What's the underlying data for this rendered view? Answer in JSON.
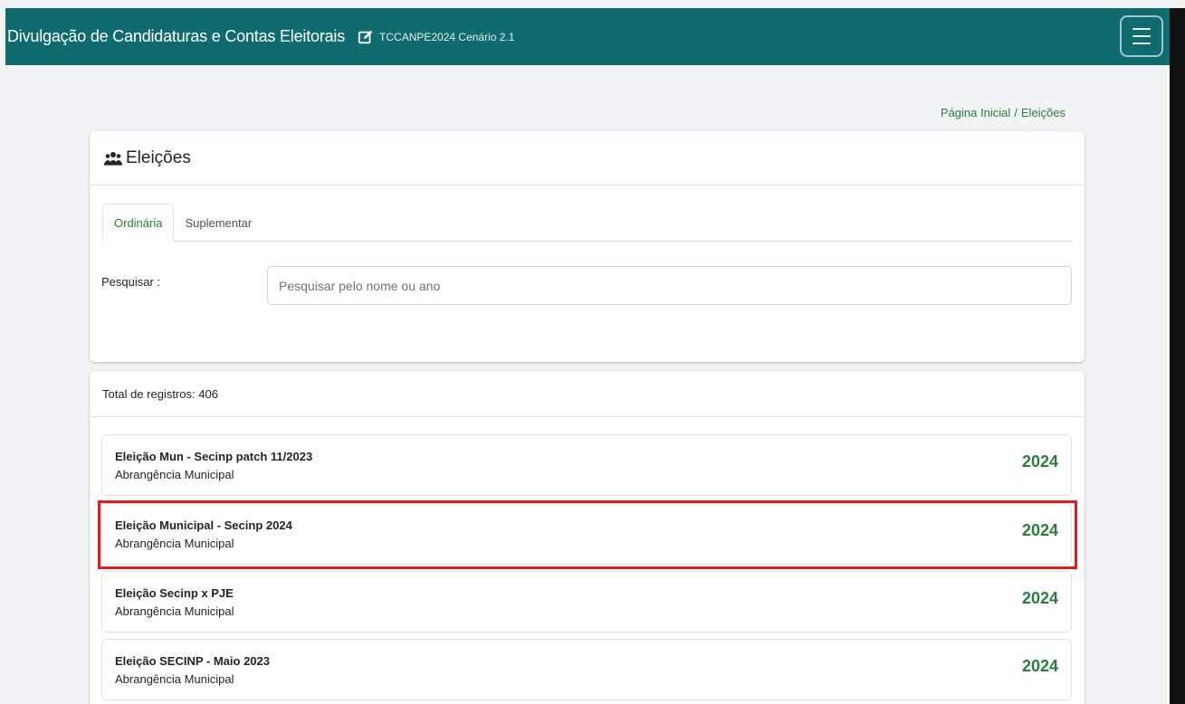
{
  "header": {
    "title": "Divulgação de Candidaturas e Contas Eleitorais",
    "subtitle": "TCCANPE2024 Cenário 2.1",
    "edit_icon": "edit-icon",
    "menu_icon": "menu-icon"
  },
  "breadcrumb": {
    "home": "Página Inicial",
    "separator": "/",
    "current": "Eleições"
  },
  "page": {
    "title": "Eleições",
    "title_icon": "users-icon"
  },
  "tabs": [
    {
      "label": "Ordinária",
      "active": true
    },
    {
      "label": "Suplementar",
      "active": false
    }
  ],
  "search": {
    "label": "Pesquisar :",
    "placeholder": "Pesquisar pelo nome ou ano",
    "value": ""
  },
  "results": {
    "total_label": "Total de registros:",
    "total_value": "406",
    "items": [
      {
        "name": "Eleição Mun - Secinp patch 11/2023",
        "scope": "Abrangência Municipal",
        "year": "2024"
      },
      {
        "name": "Eleição Municipal - Secinp 2024",
        "scope": "Abrangência Municipal",
        "year": "2024",
        "highlighted": true
      },
      {
        "name": "Eleição Secinp x PJE",
        "scope": "Abrangência Municipal",
        "year": "2024"
      },
      {
        "name": "Eleição SECINP - Maio 2023",
        "scope": "Abrangência Municipal",
        "year": "2024"
      }
    ]
  },
  "colors": {
    "header_bg": "#0f6b6e",
    "accent_green": "#2b7d3c",
    "highlight_red": "#e31b1b"
  }
}
